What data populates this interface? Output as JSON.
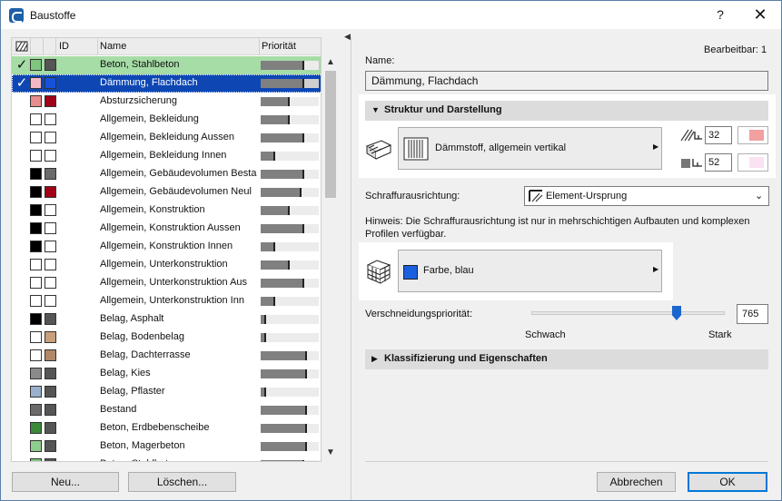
{
  "window": {
    "title": "Baustoffe",
    "help": "?",
    "close": "✕"
  },
  "list": {
    "headers": {
      "id": "ID",
      "name": "Name",
      "priority": "Priorität"
    },
    "rows": [
      {
        "name": "Beton, Stahlbeton",
        "checked": true,
        "sw1": "#7fc77f",
        "sw2": "#555555",
        "prio": 0.75,
        "state": "green"
      },
      {
        "name": "Dämmung, Flachdach",
        "checked": true,
        "sw1": "#f2b8c6",
        "sw2": "#1652d9",
        "prio": 0.75,
        "state": "blue"
      },
      {
        "name": "Absturzsicherung",
        "checked": false,
        "sw1": "#e88c8c",
        "sw2": "#a00018",
        "prio": 0.5,
        "state": ""
      },
      {
        "name": "Allgemein, Bekleidung",
        "checked": false,
        "sw1": "#ffffff",
        "sw2": "#ffffff",
        "prio": 0.5,
        "state": ""
      },
      {
        "name": "Allgemein, Bekleidung Aussen",
        "checked": false,
        "sw1": "#ffffff",
        "sw2": "#ffffff",
        "prio": 0.75,
        "state": ""
      },
      {
        "name": "Allgemein, Bekleidung Innen",
        "checked": false,
        "sw1": "#ffffff",
        "sw2": "#ffffff",
        "prio": 0.25,
        "state": ""
      },
      {
        "name": "Allgemein, Gebäudevolumen Besta",
        "checked": false,
        "sw1": "#000000",
        "sw2": "#6b6b6b",
        "prio": 0.75,
        "state": ""
      },
      {
        "name": "Allgemein, Gebäudevolumen Neul",
        "checked": false,
        "sw1": "#000000",
        "sw2": "#a00018",
        "prio": 0.7,
        "state": ""
      },
      {
        "name": "Allgemein, Konstruktion",
        "checked": false,
        "sw1": "#000000",
        "sw2": "#ffffff",
        "prio": 0.5,
        "state": ""
      },
      {
        "name": "Allgemein, Konstruktion Aussen",
        "checked": false,
        "sw1": "#000000",
        "sw2": "#ffffff",
        "prio": 0.75,
        "state": ""
      },
      {
        "name": "Allgemein, Konstruktion Innen",
        "checked": false,
        "sw1": "#000000",
        "sw2": "#ffffff",
        "prio": 0.25,
        "state": ""
      },
      {
        "name": "Allgemein, Unterkonstruktion",
        "checked": false,
        "sw1": "#ffffff",
        "sw2": "#ffffff",
        "prio": 0.5,
        "state": ""
      },
      {
        "name": "Allgemein, Unterkonstruktion Aus",
        "checked": false,
        "sw1": "#ffffff",
        "sw2": "#ffffff",
        "prio": 0.75,
        "state": ""
      },
      {
        "name": "Allgemein, Unterkonstruktion Inn",
        "checked": false,
        "sw1": "#ffffff",
        "sw2": "#ffffff",
        "prio": 0.25,
        "state": ""
      },
      {
        "name": "Belag, Asphalt",
        "checked": false,
        "sw1": "#000000",
        "sw2": "#555555",
        "prio": 0.1,
        "state": ""
      },
      {
        "name": "Belag, Bodenbelag",
        "checked": false,
        "sw1": "#ffffff",
        "sw2": "#c8a07a",
        "prio": 0.1,
        "state": ""
      },
      {
        "name": "Belag, Dachterrasse",
        "checked": false,
        "sw1": "#ffffff",
        "sw2": "#b08868",
        "prio": 0.8,
        "state": ""
      },
      {
        "name": "Belag, Kies",
        "checked": false,
        "sw1": "#8a8a8a",
        "sw2": "#555555",
        "prio": 0.8,
        "state": ""
      },
      {
        "name": "Belag, Pflaster",
        "checked": false,
        "sw1": "#9ab0cc",
        "sw2": "#555555",
        "prio": 0.1,
        "state": ""
      },
      {
        "name": "Bestand",
        "checked": false,
        "sw1": "#6a6a6a",
        "sw2": "#555555",
        "prio": 0.8,
        "state": ""
      },
      {
        "name": "Beton, Erdbebenscheibe",
        "checked": false,
        "sw1": "#3a8a3a",
        "sw2": "#555555",
        "prio": 0.8,
        "state": ""
      },
      {
        "name": "Beton, Magerbeton",
        "checked": false,
        "sw1": "#8fcc8f",
        "sw2": "#555555",
        "prio": 0.8,
        "state": ""
      },
      {
        "name": "Beton, Stahlbeton",
        "checked": false,
        "sw1": "#7fc77f",
        "sw2": "#555555",
        "prio": 0.75,
        "state": ""
      }
    ]
  },
  "buttons": {
    "new": "Neu...",
    "delete": "Löschen...",
    "cancel": "Abbrechen",
    "ok": "OK"
  },
  "right": {
    "editable": "Bearbeitbar: 1",
    "name_label": "Name:",
    "name_value": "Dämmung, Flachdach",
    "section_struktur": "Struktur und Darstellung",
    "fill_picker": "Dämmstoff, allgemein vertikal",
    "pen_fg": "32",
    "pen_bg": "52",
    "fg_color": "#f2a0a0",
    "bg_color": "#fbe2f2",
    "hatch_orient_label": "Schraffurausrichtung:",
    "hatch_orient_value": "Element-Ursprung",
    "hint": "Hinweis: Die Schraffurausrichtung ist nur in mehrschichtigen Aufbauten und komplexen Profilen verfügbar.",
    "surface_picker": "Farbe, blau",
    "surface_color": "#1a5fe0",
    "intersection_label": "Verschneidungspriorität:",
    "weak": "Schwach",
    "strong": "Stark",
    "intersection_value": "765",
    "intersection_fraction": 0.77,
    "section_classification": "Klassifizierung und Eigenschaften"
  }
}
